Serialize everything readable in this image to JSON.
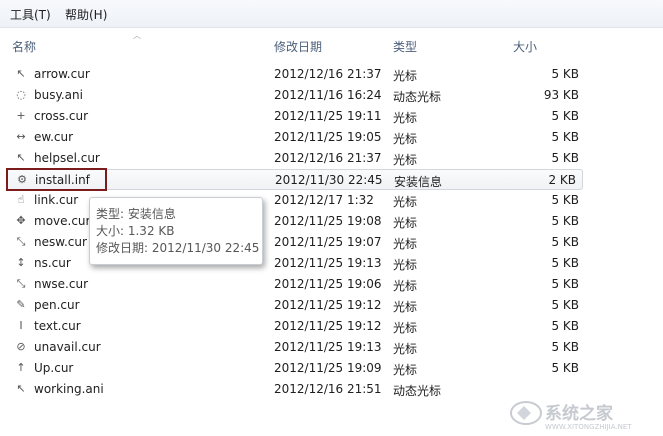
{
  "menu": {
    "items": [
      "工具(T)",
      "帮助(H)"
    ]
  },
  "columns": {
    "name": "名称",
    "date": "修改日期",
    "type": "类型",
    "size": "大小"
  },
  "files": [
    {
      "name": "arrow.cur",
      "date": "2012/12/16 21:37",
      "type": "光标",
      "size": "5 KB",
      "icon": "arrow-cursor-icon"
    },
    {
      "name": "busy.ani",
      "date": "2012/11/16 16:24",
      "type": "动态光标",
      "size": "93 KB",
      "icon": "busy-cursor-icon"
    },
    {
      "name": "cross.cur",
      "date": "2012/11/25 19:11",
      "type": "光标",
      "size": "5 KB",
      "icon": "cross-cursor-icon"
    },
    {
      "name": "ew.cur",
      "date": "2012/11/25 19:05",
      "type": "光标",
      "size": "5 KB",
      "icon": "horizontal-resize-cursor-icon"
    },
    {
      "name": "helpsel.cur",
      "date": "2012/12/16 21:37",
      "type": "光标",
      "size": "5 KB",
      "icon": "help-cursor-icon"
    },
    {
      "name": "install.inf",
      "date": "2012/11/30 22:45",
      "type": "安装信息",
      "size": "2 KB",
      "icon": "setup-file-icon"
    },
    {
      "name": "link.cur",
      "date": "2012/12/17 1:32",
      "type": "光标",
      "size": "5 KB",
      "icon": "hand-cursor-icon"
    },
    {
      "name": "move.cur",
      "date": "2012/11/25 19:08",
      "type": "光标",
      "size": "5 KB",
      "icon": "move-cursor-icon"
    },
    {
      "name": "nesw.cur",
      "date": "2012/11/25 19:07",
      "type": "光标",
      "size": "5 KB",
      "icon": "diagonal-resize-cursor-icon"
    },
    {
      "name": "ns.cur",
      "date": "2012/11/25 19:13",
      "type": "光标",
      "size": "5 KB",
      "icon": "vertical-resize-cursor-icon"
    },
    {
      "name": "nwse.cur",
      "date": "2012/11/25 19:06",
      "type": "光标",
      "size": "5 KB",
      "icon": "diagonal-resize-cursor-icon"
    },
    {
      "name": "pen.cur",
      "date": "2012/11/25 19:12",
      "type": "光标",
      "size": "5 KB",
      "icon": "pen-cursor-icon"
    },
    {
      "name": "text.cur",
      "date": "2012/11/25 19:12",
      "type": "光标",
      "size": "5 KB",
      "icon": "text-cursor-icon"
    },
    {
      "name": "unavail.cur",
      "date": "2012/11/25 19:13",
      "type": "光标",
      "size": "5 KB",
      "icon": "unavailable-cursor-icon"
    },
    {
      "name": "Up.cur",
      "date": "2012/11/25 19:09",
      "type": "光标",
      "size": "5 KB",
      "icon": "up-arrow-cursor-icon"
    },
    {
      "name": "working.ani",
      "date": "2012/12/16 21:51",
      "type": "动态光标",
      "size": "",
      "icon": "working-cursor-icon"
    }
  ],
  "tooltip": {
    "type_line": "类型: 安装信息",
    "size_line": "大小: 1.32 KB",
    "date_line": "修改日期: 2012/11/30 22:45"
  },
  "watermark": {
    "text": "系统之家",
    "url": "WWW.XITONGZHIJIA.NET"
  }
}
